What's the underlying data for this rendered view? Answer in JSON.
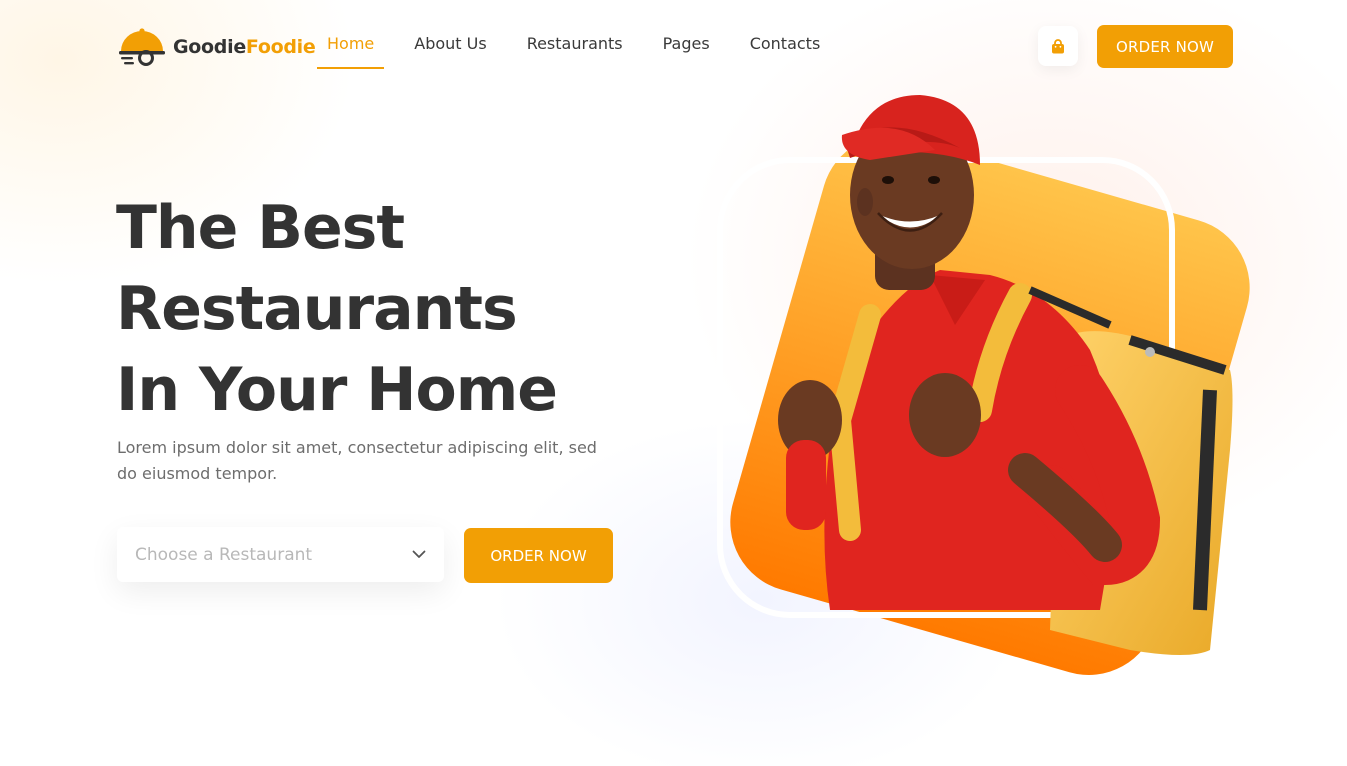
{
  "brand": {
    "part1": "Goodie",
    "part2": "Foodie",
    "accent": "#f29f05"
  },
  "nav": [
    {
      "label": "Home",
      "active": true
    },
    {
      "label": "About Us"
    },
    {
      "label": "Restaurants"
    },
    {
      "label": "Pages"
    },
    {
      "label": "Contacts"
    }
  ],
  "header": {
    "cart_icon": "shopping-bag-icon",
    "order_label": "ORDER NOW"
  },
  "hero": {
    "title_lines": [
      "The Best",
      "Restaurants",
      "In Your Home"
    ],
    "description": "Lorem ipsum dolor sit amet, consectetur adipiscing elit, sed do eiusmod tempor.",
    "select_placeholder": "Choose a Restaurant",
    "select_icon": "chevron-down-icon",
    "order_label": "ORDER NOW",
    "image": "delivery-man-photo"
  },
  "colors": {
    "accent": "#f29f05",
    "heading": "#333333",
    "text": "#6d6d6d",
    "gradient_top": "#ffc44a",
    "gradient_bottom": "#ff7a00"
  }
}
